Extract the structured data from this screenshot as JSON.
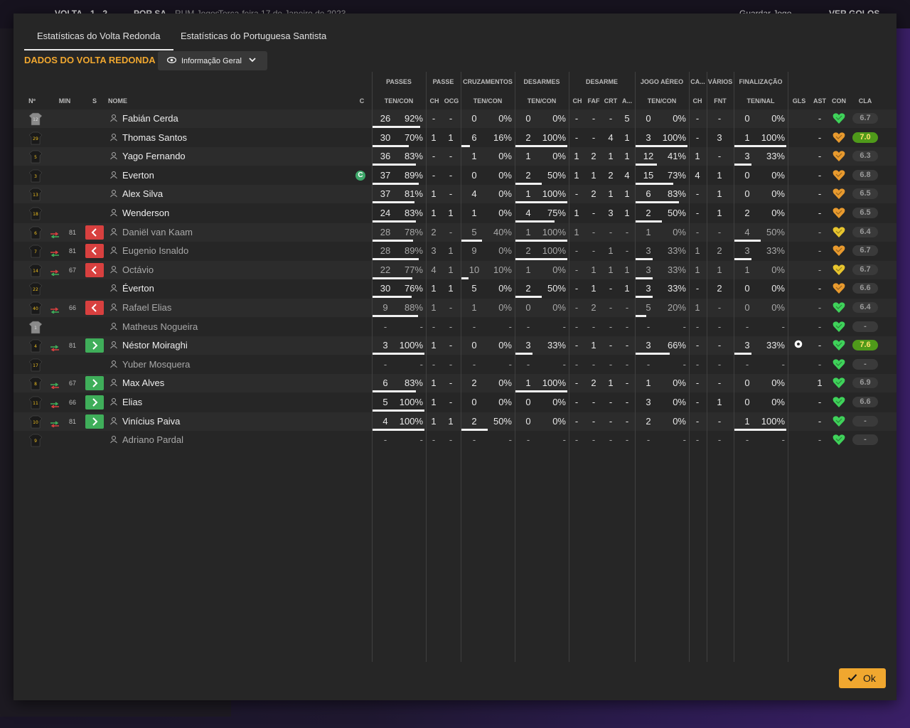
{
  "background": {
    "score_home": "VOLTA",
    "score": "1 - 2",
    "score_away": "POR SA",
    "sub1": "RUM Jogos",
    "date": "Terça-feira 17 de Janeiro de 2023",
    "save_label": "Guardar Jogo",
    "goals_label": "VER GOLOS"
  },
  "tabs": [
    {
      "label": "Estatísticas do Volta Redonda"
    },
    {
      "label": "Estatísticas do Portuguesa Santista"
    }
  ],
  "section_title": "DADOS DO VOLTA REDONDA",
  "view_dropdown": {
    "label": "Informação Geral"
  },
  "group_headers": [
    "PASSES",
    "PASSE",
    "CRUZAMENTOS",
    "DESARMES",
    "DESARME",
    "JOGO AÉREO",
    "CA...",
    "VÁRIOS",
    "FINALIZAÇÃO"
  ],
  "columns": {
    "no": "Nº",
    "min": "MIN",
    "s": "S",
    "name": "NOME",
    "c": "C",
    "passes": "TEN/CON",
    "passe_ch": "CH",
    "passe_ocg": "OCG",
    "cruz": "TEN/CON",
    "desarmes": "TEN/CON",
    "des_ch": "CH",
    "des_faf": "FAF",
    "des_crt": "CRT",
    "des_a": "A...",
    "aereo": "TEN/CON",
    "ca_ch": "CH",
    "var_fnt": "FNT",
    "fin": "TEN/NAL",
    "gls": "GLS",
    "ast": "AST",
    "con": "CON",
    "cla": "CLA"
  },
  "colors": {
    "accent": "#f0a72f",
    "sub_out": "#d8403f",
    "sub_in": "#3fae5a",
    "best_rating": "#4f9a1a",
    "shirt_yellow": "#f0c020",
    "heart_green": "#3fd25a",
    "heart_yellow": "#e8c52e",
    "heart_orange": "#e89a2e"
  },
  "players": [
    {
      "no": "12",
      "gk": true,
      "name": "Fabián Cerda",
      "min": "",
      "sub": "",
      "captain": false,
      "passes_t": "26",
      "passes_p": "92%",
      "passes_f": 0.92,
      "ch": "-",
      "ocg": "-",
      "cruz_t": "0",
      "cruz_p": "0%",
      "cruz_f": 0,
      "des_t": "0",
      "des_p": "0%",
      "des_f": 0,
      "dch": "-",
      "faf": "-",
      "crt": "-",
      "da": "5",
      "aer_t": "0",
      "aer_p": "0%",
      "aer_f": 0,
      "cach": "-",
      "fnt": "-",
      "fin_t": "0",
      "fin_p": "0%",
      "fin_f": 0,
      "gls": "",
      "ast": "-",
      "heart": "green",
      "cla": "6.7",
      "best": false
    },
    {
      "no": "29",
      "gk": false,
      "name": "Thomas Santos",
      "min": "",
      "sub": "",
      "captain": false,
      "passes_t": "30",
      "passes_p": "70%",
      "passes_f": 0.7,
      "ch": "1",
      "ocg": "1",
      "cruz_t": "6",
      "cruz_p": "16%",
      "cruz_f": 0.16,
      "des_t": "2",
      "des_p": "100%",
      "des_f": 1,
      "dch": "-",
      "faf": "-",
      "crt": "4",
      "da": "1",
      "aer_t": "3",
      "aer_p": "100%",
      "aer_f": 1,
      "cach": "-",
      "fnt": "3",
      "fin_t": "1",
      "fin_p": "100%",
      "fin_f": 1,
      "gls": "",
      "ast": "-",
      "heart": "orange",
      "cla": "7.0",
      "best": true
    },
    {
      "no": "5",
      "gk": false,
      "name": "Yago Fernando",
      "min": "",
      "sub": "",
      "captain": false,
      "passes_t": "36",
      "passes_p": "83%",
      "passes_f": 0.83,
      "ch": "-",
      "ocg": "-",
      "cruz_t": "1",
      "cruz_p": "0%",
      "cruz_f": 0,
      "des_t": "1",
      "des_p": "0%",
      "des_f": 0,
      "dch": "1",
      "faf": "2",
      "crt": "1",
      "da": "1",
      "aer_t": "12",
      "aer_p": "41%",
      "aer_f": 0.41,
      "cach": "1",
      "fnt": "-",
      "fin_t": "3",
      "fin_p": "33%",
      "fin_f": 0.33,
      "gls": "",
      "ast": "-",
      "heart": "orange",
      "cla": "6.3",
      "best": false
    },
    {
      "no": "3",
      "gk": false,
      "name": "Everton",
      "min": "",
      "sub": "",
      "captain": true,
      "passes_t": "37",
      "passes_p": "89%",
      "passes_f": 0.89,
      "ch": "-",
      "ocg": "-",
      "cruz_t": "0",
      "cruz_p": "0%",
      "cruz_f": 0,
      "des_t": "2",
      "des_p": "50%",
      "des_f": 0.5,
      "dch": "1",
      "faf": "1",
      "crt": "2",
      "da": "4",
      "aer_t": "15",
      "aer_p": "73%",
      "aer_f": 0.73,
      "cach": "4",
      "fnt": "1",
      "fin_t": "0",
      "fin_p": "0%",
      "fin_f": 0,
      "gls": "",
      "ast": "-",
      "heart": "orange",
      "cla": "6.8",
      "best": false
    },
    {
      "no": "13",
      "gk": false,
      "name": "Alex Silva",
      "min": "",
      "sub": "",
      "captain": false,
      "passes_t": "37",
      "passes_p": "81%",
      "passes_f": 0.81,
      "ch": "1",
      "ocg": "-",
      "cruz_t": "4",
      "cruz_p": "0%",
      "cruz_f": 0,
      "des_t": "1",
      "des_p": "100%",
      "des_f": 1,
      "dch": "-",
      "faf": "2",
      "crt": "1",
      "da": "1",
      "aer_t": "6",
      "aer_p": "83%",
      "aer_f": 0.83,
      "cach": "-",
      "fnt": "1",
      "fin_t": "0",
      "fin_p": "0%",
      "fin_f": 0,
      "gls": "",
      "ast": "-",
      "heart": "orange",
      "cla": "6.5",
      "best": false
    },
    {
      "no": "18",
      "gk": false,
      "name": "Wenderson",
      "min": "",
      "sub": "",
      "captain": false,
      "passes_t": "24",
      "passes_p": "83%",
      "passes_f": 0.83,
      "ch": "1",
      "ocg": "1",
      "cruz_t": "1",
      "cruz_p": "0%",
      "cruz_f": 0,
      "des_t": "4",
      "des_p": "75%",
      "des_f": 0.75,
      "dch": "1",
      "faf": "-",
      "crt": "3",
      "da": "1",
      "aer_t": "2",
      "aer_p": "50%",
      "aer_f": 0.5,
      "cach": "-",
      "fnt": "1",
      "fin_t": "2",
      "fin_p": "0%",
      "fin_f": 0,
      "gls": "",
      "ast": "-",
      "heart": "orange",
      "cla": "6.5",
      "best": false
    },
    {
      "no": "6",
      "gk": false,
      "name": "Daniël van Kaam",
      "dim": true,
      "min": "81",
      "sub": "out",
      "captain": false,
      "passes_t": "28",
      "passes_p": "78%",
      "passes_f": 0.78,
      "ch": "2",
      "ocg": "-",
      "cruz_t": "5",
      "cruz_p": "40%",
      "cruz_f": 0.4,
      "des_t": "1",
      "des_p": "100%",
      "des_f": 1,
      "dch": "1",
      "faf": "-",
      "crt": "-",
      "da": "-",
      "aer_t": "1",
      "aer_p": "0%",
      "aer_f": 0,
      "cach": "-",
      "fnt": "-",
      "fin_t": "4",
      "fin_p": "50%",
      "fin_f": 0.5,
      "gls": "",
      "ast": "-",
      "heart": "yellow",
      "cla": "6.4",
      "best": false
    },
    {
      "no": "7",
      "gk": false,
      "name": "Eugenio Isnaldo",
      "dim": true,
      "min": "81",
      "sub": "out",
      "captain": false,
      "passes_t": "28",
      "passes_p": "89%",
      "passes_f": 0.89,
      "ch": "3",
      "ocg": "1",
      "cruz_t": "9",
      "cruz_p": "0%",
      "cruz_f": 0,
      "des_t": "2",
      "des_p": "100%",
      "des_f": 1,
      "dch": "-",
      "faf": "-",
      "crt": "1",
      "da": "-",
      "aer_t": "3",
      "aer_p": "33%",
      "aer_f": 0.33,
      "cach": "1",
      "fnt": "2",
      "fin_t": "3",
      "fin_p": "33%",
      "fin_f": 0.33,
      "gls": "",
      "ast": "-",
      "heart": "orange",
      "cla": "6.7",
      "best": false
    },
    {
      "no": "14",
      "gk": false,
      "name": "Octávio",
      "dim": true,
      "min": "67",
      "sub": "out",
      "captain": false,
      "passes_t": "22",
      "passes_p": "77%",
      "passes_f": 0.77,
      "ch": "4",
      "ocg": "1",
      "cruz_t": "10",
      "cruz_p": "10%",
      "cruz_f": 0.1,
      "des_t": "1",
      "des_p": "0%",
      "des_f": 0,
      "dch": "-",
      "faf": "1",
      "crt": "1",
      "da": "1",
      "aer_t": "3",
      "aer_p": "33%",
      "aer_f": 0.33,
      "cach": "1",
      "fnt": "1",
      "fin_t": "1",
      "fin_p": "0%",
      "fin_f": 0,
      "gls": "",
      "ast": "-",
      "heart": "yellow",
      "cla": "6.7",
      "best": false
    },
    {
      "no": "22",
      "gk": false,
      "name": "Éverton",
      "min": "",
      "sub": "",
      "captain": false,
      "passes_t": "30",
      "passes_p": "76%",
      "passes_f": 0.76,
      "ch": "1",
      "ocg": "1",
      "cruz_t": "5",
      "cruz_p": "0%",
      "cruz_f": 0,
      "des_t": "2",
      "des_p": "50%",
      "des_f": 0.5,
      "dch": "-",
      "faf": "1",
      "crt": "-",
      "da": "1",
      "aer_t": "3",
      "aer_p": "33%",
      "aer_f": 0.33,
      "cach": "-",
      "fnt": "2",
      "fin_t": "0",
      "fin_p": "0%",
      "fin_f": 0,
      "gls": "",
      "ast": "-",
      "heart": "orange",
      "cla": "6.6",
      "best": false
    },
    {
      "no": "40",
      "gk": false,
      "name": "Rafael Elias",
      "dim": true,
      "min": "66",
      "sub": "out",
      "captain": false,
      "passes_t": "9",
      "passes_p": "88%",
      "passes_f": 0.88,
      "ch": "1",
      "ocg": "-",
      "cruz_t": "1",
      "cruz_p": "0%",
      "cruz_f": 0,
      "des_t": "0",
      "des_p": "0%",
      "des_f": 0,
      "dch": "-",
      "faf": "2",
      "crt": "-",
      "da": "-",
      "aer_t": "5",
      "aer_p": "20%",
      "aer_f": 0.2,
      "cach": "1",
      "fnt": "-",
      "fin_t": "0",
      "fin_p": "0%",
      "fin_f": 0,
      "gls": "",
      "ast": "-",
      "heart": "green",
      "cla": "6.4",
      "best": false
    },
    {
      "no": "1",
      "gk": true,
      "name": "Matheus Nogueira",
      "dim": true,
      "min": "",
      "sub": "",
      "captain": false,
      "passes_t": "-",
      "passes_p": "-",
      "passes_f": 0,
      "ch": "-",
      "ocg": "-",
      "cruz_t": "-",
      "cruz_p": "-",
      "cruz_f": 0,
      "des_t": "-",
      "des_p": "-",
      "des_f": 0,
      "dch": "-",
      "faf": "-",
      "crt": "-",
      "da": "-",
      "aer_t": "-",
      "aer_p": "-",
      "aer_f": 0,
      "cach": "-",
      "fnt": "-",
      "fin_t": "-",
      "fin_p": "-",
      "fin_f": 0,
      "gls": "",
      "ast": "-",
      "heart": "green",
      "cla": "-",
      "best": false
    },
    {
      "no": "4",
      "gk": false,
      "name": "Néstor Moiraghi",
      "min": "81",
      "sub": "in",
      "captain": false,
      "passes_t": "3",
      "passes_p": "100%",
      "passes_f": 1,
      "ch": "1",
      "ocg": "-",
      "cruz_t": "0",
      "cruz_p": "0%",
      "cruz_f": 0,
      "des_t": "3",
      "des_p": "33%",
      "des_f": 0.33,
      "dch": "-",
      "faf": "1",
      "crt": "-",
      "da": "-",
      "aer_t": "3",
      "aer_p": "66%",
      "aer_f": 0.66,
      "cach": "-",
      "fnt": "-",
      "fin_t": "3",
      "fin_p": "33%",
      "fin_f": 0.33,
      "gls": "ball",
      "ast": "-",
      "heart": "green",
      "cla": "7.6",
      "best": true
    },
    {
      "no": "17",
      "gk": false,
      "name": "Yuber Mosquera",
      "dim": true,
      "min": "",
      "sub": "",
      "captain": false,
      "passes_t": "-",
      "passes_p": "-",
      "passes_f": 0,
      "ch": "-",
      "ocg": "-",
      "cruz_t": "-",
      "cruz_p": "-",
      "cruz_f": 0,
      "des_t": "-",
      "des_p": "-",
      "des_f": 0,
      "dch": "-",
      "faf": "-",
      "crt": "-",
      "da": "-",
      "aer_t": "-",
      "aer_p": "-",
      "aer_f": 0,
      "cach": "-",
      "fnt": "-",
      "fin_t": "-",
      "fin_p": "-",
      "fin_f": 0,
      "gls": "",
      "ast": "-",
      "heart": "green",
      "cla": "-",
      "best": false
    },
    {
      "no": "8",
      "gk": false,
      "name": "Max Alves",
      "min": "67",
      "sub": "in",
      "captain": false,
      "passes_t": "6",
      "passes_p": "83%",
      "passes_f": 0.83,
      "ch": "1",
      "ocg": "-",
      "cruz_t": "2",
      "cruz_p": "0%",
      "cruz_f": 0,
      "des_t": "1",
      "des_p": "100%",
      "des_f": 1,
      "dch": "-",
      "faf": "2",
      "crt": "1",
      "da": "-",
      "aer_t": "1",
      "aer_p": "0%",
      "aer_f": 0,
      "cach": "-",
      "fnt": "-",
      "fin_t": "0",
      "fin_p": "0%",
      "fin_f": 0,
      "gls": "",
      "ast": "1",
      "heart": "green",
      "cla": "6.9",
      "best": false
    },
    {
      "no": "11",
      "gk": false,
      "name": "Elias",
      "min": "66",
      "sub": "in",
      "captain": false,
      "passes_t": "5",
      "passes_p": "100%",
      "passes_f": 1,
      "ch": "1",
      "ocg": "-",
      "cruz_t": "0",
      "cruz_p": "0%",
      "cruz_f": 0,
      "des_t": "0",
      "des_p": "0%",
      "des_f": 0,
      "dch": "-",
      "faf": "-",
      "crt": "-",
      "da": "-",
      "aer_t": "3",
      "aer_p": "0%",
      "aer_f": 0,
      "cach": "-",
      "fnt": "1",
      "fin_t": "0",
      "fin_p": "0%",
      "fin_f": 0,
      "gls": "",
      "ast": "-",
      "heart": "green",
      "cla": "6.6",
      "best": false
    },
    {
      "no": "10",
      "gk": false,
      "name": "Vinícius Paiva",
      "min": "81",
      "sub": "in",
      "captain": false,
      "passes_t": "4",
      "passes_p": "100%",
      "passes_f": 1,
      "ch": "1",
      "ocg": "1",
      "cruz_t": "2",
      "cruz_p": "50%",
      "cruz_f": 0.5,
      "des_t": "0",
      "des_p": "0%",
      "des_f": 0,
      "dch": "-",
      "faf": "-",
      "crt": "-",
      "da": "-",
      "aer_t": "2",
      "aer_p": "0%",
      "aer_f": 0,
      "cach": "-",
      "fnt": "-",
      "fin_t": "1",
      "fin_p": "100%",
      "fin_f": 1,
      "gls": "",
      "ast": "-",
      "heart": "green",
      "cla": "-",
      "best": false
    },
    {
      "no": "9",
      "gk": false,
      "name": "Adriano Pardal",
      "dim": true,
      "min": "",
      "sub": "",
      "captain": false,
      "passes_t": "-",
      "passes_p": "-",
      "passes_f": 0,
      "ch": "-",
      "ocg": "-",
      "cruz_t": "-",
      "cruz_p": "-",
      "cruz_f": 0,
      "des_t": "-",
      "des_p": "-",
      "des_f": 0,
      "dch": "-",
      "faf": "-",
      "crt": "-",
      "da": "-",
      "aer_t": "-",
      "aer_p": "-",
      "aer_f": 0,
      "cach": "-",
      "fnt": "-",
      "fin_t": "-",
      "fin_p": "-",
      "fin_f": 0,
      "gls": "",
      "ast": "-",
      "heart": "green",
      "cla": "-",
      "best": false
    }
  ],
  "ok_label": "Ok"
}
